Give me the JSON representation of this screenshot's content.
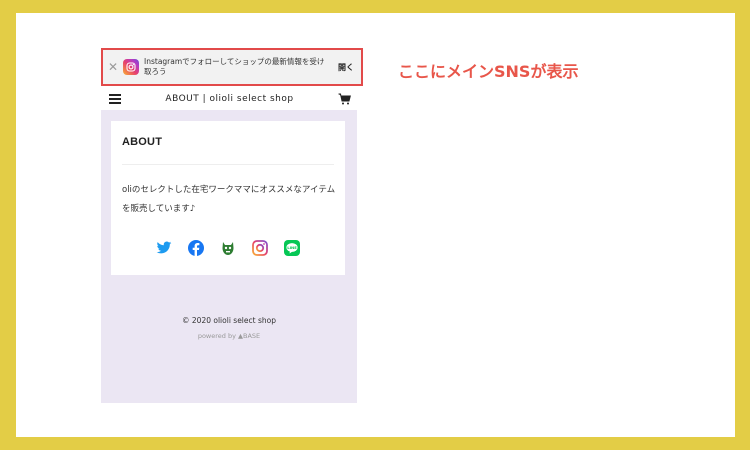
{
  "banner": {
    "message": "Instagramでフォローしてショップの最新情報を受け取ろう",
    "open_label": "開く",
    "close_glyph": "✕",
    "highlight_color": "#e24a4a"
  },
  "header": {
    "title": "ABOUT | olioli select shop"
  },
  "about": {
    "heading": "ABOUT",
    "description": "oliのセレクトした在宅ワークママにオススメなアイテムを販売しています♪"
  },
  "sns_icons": [
    "twitter-icon",
    "facebook-icon",
    "peing-icon",
    "instagram-icon",
    "line-icon"
  ],
  "footer": {
    "copyright": "© 2020 olioli select shop",
    "powered_by": "powered by ▲BASE"
  },
  "annotation": {
    "callout": "ここにメインSNSが表示"
  },
  "colors": {
    "frame": "#e3cd46",
    "lavender": "#ebe6f3",
    "callout": "#e8564a"
  }
}
